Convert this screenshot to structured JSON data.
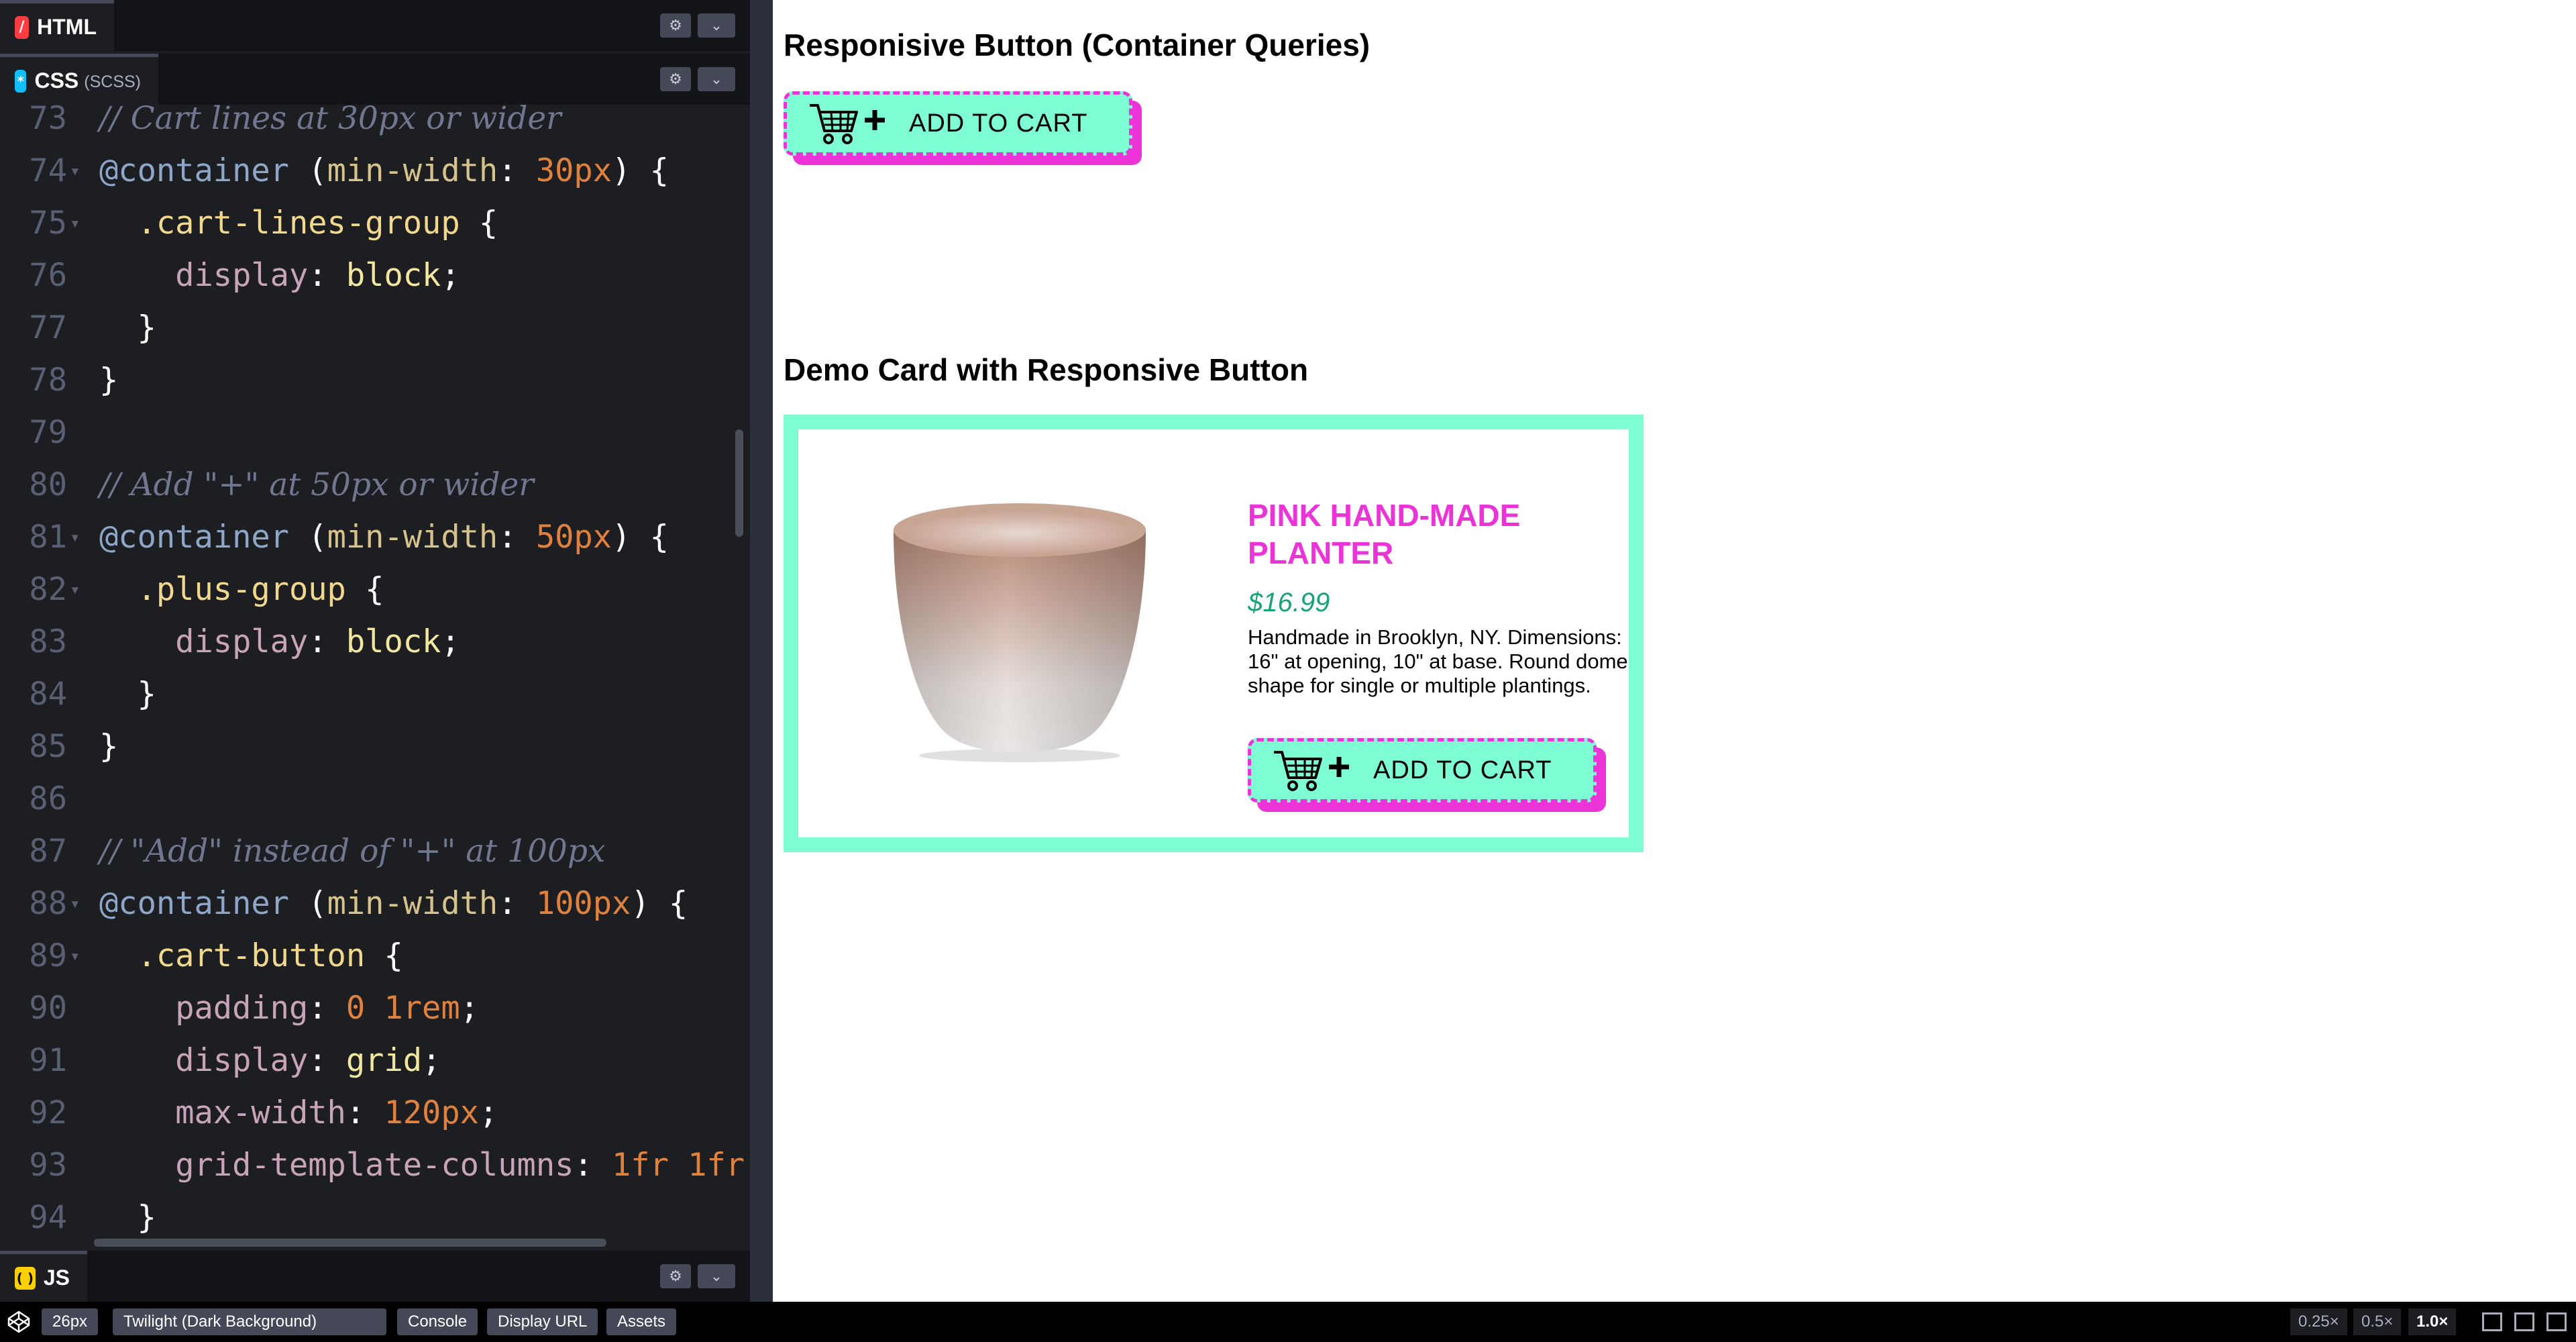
{
  "editor": {
    "html_tab": {
      "label": "HTML",
      "icon": "html-icon"
    },
    "css_tab": {
      "label": "CSS",
      "sublabel": "(SCSS)",
      "icon": "css-icon"
    },
    "js_tab": {
      "label": "JS",
      "icon": "js-icon"
    },
    "settings_glyph": "⚙",
    "collapse_glyph": "⌄",
    "code_lines": [
      {
        "n": "73",
        "fold": false,
        "tokens": [
          [
            "c",
            "// Cart lines at 30px or wider"
          ]
        ]
      },
      {
        "n": "74",
        "fold": true,
        "tokens": [
          [
            "a",
            "@container"
          ],
          [
            "p",
            " ("
          ],
          [
            "k",
            "min-width"
          ],
          [
            "p",
            ": "
          ],
          [
            "n",
            "30px"
          ],
          [
            "p",
            ") {"
          ]
        ]
      },
      {
        "n": "75",
        "fold": true,
        "tokens": [
          [
            "p",
            "  "
          ],
          [
            "s",
            ".cart-lines-group"
          ],
          [
            "p",
            " {"
          ]
        ]
      },
      {
        "n": "76",
        "fold": false,
        "tokens": [
          [
            "p",
            "    "
          ],
          [
            "y",
            "display"
          ],
          [
            "p",
            ": "
          ],
          [
            "v",
            "block"
          ],
          [
            "p",
            ";"
          ]
        ]
      },
      {
        "n": "77",
        "fold": false,
        "tokens": [
          [
            "p",
            "  }"
          ]
        ]
      },
      {
        "n": "78",
        "fold": false,
        "tokens": [
          [
            "p",
            "}"
          ]
        ]
      },
      {
        "n": "79",
        "fold": false,
        "tokens": []
      },
      {
        "n": "80",
        "fold": false,
        "tokens": [
          [
            "c",
            "// Add \"+\" at 50px or wider"
          ]
        ]
      },
      {
        "n": "81",
        "fold": true,
        "tokens": [
          [
            "a",
            "@container"
          ],
          [
            "p",
            " ("
          ],
          [
            "k",
            "min-width"
          ],
          [
            "p",
            ": "
          ],
          [
            "n",
            "50px"
          ],
          [
            "p",
            ") {"
          ]
        ]
      },
      {
        "n": "82",
        "fold": true,
        "tokens": [
          [
            "p",
            "  "
          ],
          [
            "s",
            ".plus-group"
          ],
          [
            "p",
            " {"
          ]
        ]
      },
      {
        "n": "83",
        "fold": false,
        "tokens": [
          [
            "p",
            "    "
          ],
          [
            "y",
            "display"
          ],
          [
            "p",
            ": "
          ],
          [
            "v",
            "block"
          ],
          [
            "p",
            ";"
          ]
        ]
      },
      {
        "n": "84",
        "fold": false,
        "tokens": [
          [
            "p",
            "  }"
          ]
        ]
      },
      {
        "n": "85",
        "fold": false,
        "tokens": [
          [
            "p",
            "}"
          ]
        ]
      },
      {
        "n": "86",
        "fold": false,
        "tokens": []
      },
      {
        "n": "87",
        "fold": false,
        "tokens": [
          [
            "c",
            "// \"Add\" instead of \"+\" at 100px"
          ]
        ]
      },
      {
        "n": "88",
        "fold": true,
        "tokens": [
          [
            "a",
            "@container"
          ],
          [
            "p",
            " ("
          ],
          [
            "k",
            "min-width"
          ],
          [
            "p",
            ": "
          ],
          [
            "n",
            "100px"
          ],
          [
            "p",
            ") {"
          ]
        ]
      },
      {
        "n": "89",
        "fold": true,
        "tokens": [
          [
            "p",
            "  "
          ],
          [
            "s",
            ".cart-button"
          ],
          [
            "p",
            " {"
          ]
        ]
      },
      {
        "n": "90",
        "fold": false,
        "tokens": [
          [
            "p",
            "    "
          ],
          [
            "y",
            "padding"
          ],
          [
            "p",
            ": "
          ],
          [
            "n",
            "0 1rem"
          ],
          [
            "p",
            ";"
          ]
        ]
      },
      {
        "n": "91",
        "fold": false,
        "tokens": [
          [
            "p",
            "    "
          ],
          [
            "y",
            "display"
          ],
          [
            "p",
            ": "
          ],
          [
            "v",
            "grid"
          ],
          [
            "p",
            ";"
          ]
        ]
      },
      {
        "n": "92",
        "fold": false,
        "tokens": [
          [
            "p",
            "    "
          ],
          [
            "y",
            "max-width"
          ],
          [
            "p",
            ": "
          ],
          [
            "n",
            "120px"
          ],
          [
            "p",
            ";"
          ]
        ]
      },
      {
        "n": "93",
        "fold": false,
        "tokens": [
          [
            "p",
            "    "
          ],
          [
            "y",
            "grid-template-columns"
          ],
          [
            "p",
            ": "
          ],
          [
            "n",
            "1fr 1fr"
          ]
        ]
      },
      {
        "n": "94",
        "fold": false,
        "tokens": [
          [
            "p",
            "  }"
          ]
        ]
      }
    ]
  },
  "preview": {
    "heading1": "Responisive Button (Container Queries)",
    "button_label": "ADD TO CART",
    "heading2": "Demo Card with Responsive Button",
    "card": {
      "title": "PINK HAND-MADE PLANTER",
      "price": "$16.99",
      "description": "Handmade in Brooklyn, NY. Dimensions: 16\" at opening, 10\" at base. Round dome shape for single or multiple plantings.",
      "button_label": "ADD TO CART",
      "image": "planter-pot-image"
    },
    "colors": {
      "accent": "#7efcd3",
      "pink": "#ec33d7",
      "price": "#1aa27a"
    }
  },
  "bottombar": {
    "font_size": "26px",
    "theme": "Twilight (Dark Background)",
    "console": "Console",
    "display_url": "Display URL",
    "assets": "Assets",
    "zoom_options": [
      "0.25×",
      "0.5×",
      "1.0×"
    ],
    "zoom_selected": "1.0×"
  }
}
